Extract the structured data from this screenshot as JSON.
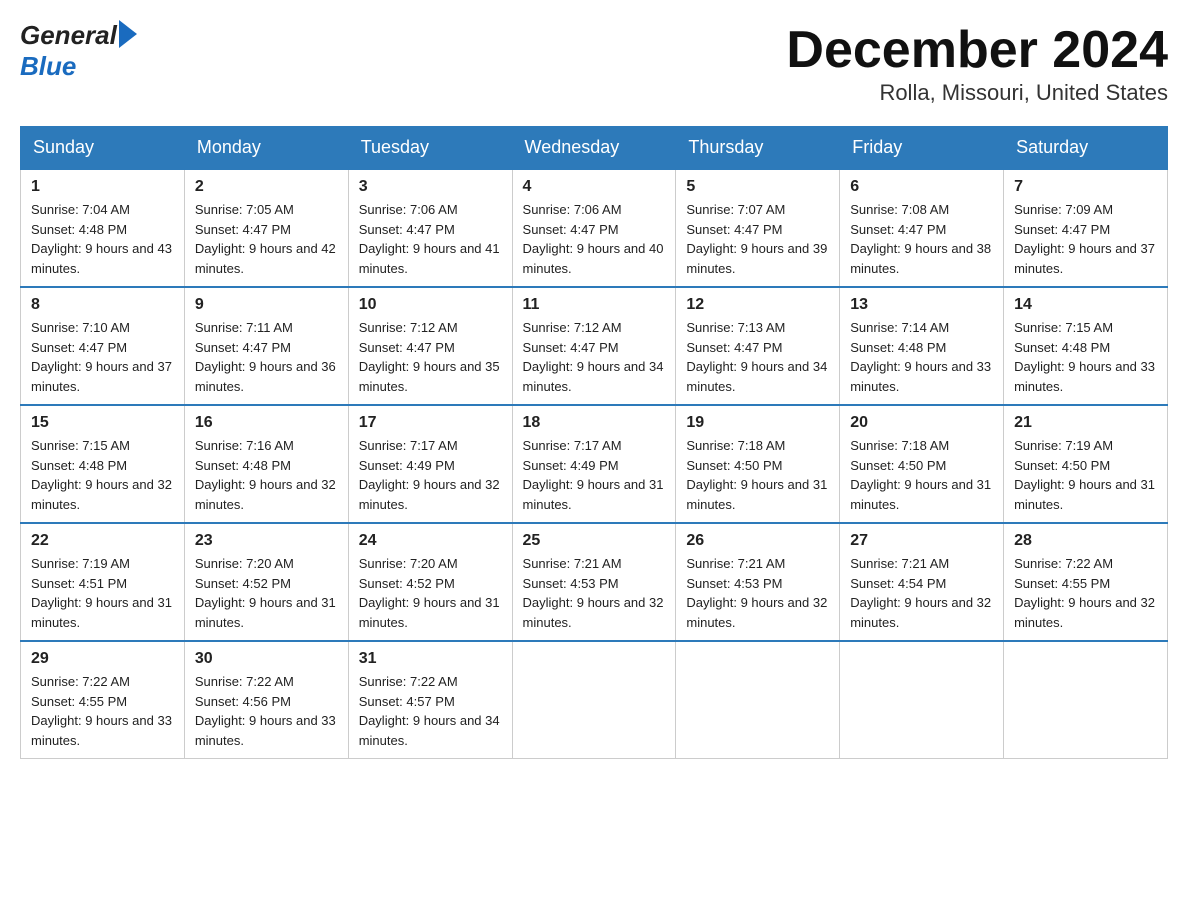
{
  "header": {
    "logo_general": "General",
    "logo_blue": "Blue",
    "month_title": "December 2024",
    "location": "Rolla, Missouri, United States"
  },
  "days_of_week": [
    "Sunday",
    "Monday",
    "Tuesday",
    "Wednesday",
    "Thursday",
    "Friday",
    "Saturday"
  ],
  "weeks": [
    [
      {
        "day": "1",
        "sunrise": "7:04 AM",
        "sunset": "4:48 PM",
        "daylight": "9 hours and 43 minutes."
      },
      {
        "day": "2",
        "sunrise": "7:05 AM",
        "sunset": "4:47 PM",
        "daylight": "9 hours and 42 minutes."
      },
      {
        "day": "3",
        "sunrise": "7:06 AM",
        "sunset": "4:47 PM",
        "daylight": "9 hours and 41 minutes."
      },
      {
        "day": "4",
        "sunrise": "7:06 AM",
        "sunset": "4:47 PM",
        "daylight": "9 hours and 40 minutes."
      },
      {
        "day": "5",
        "sunrise": "7:07 AM",
        "sunset": "4:47 PM",
        "daylight": "9 hours and 39 minutes."
      },
      {
        "day": "6",
        "sunrise": "7:08 AM",
        "sunset": "4:47 PM",
        "daylight": "9 hours and 38 minutes."
      },
      {
        "day": "7",
        "sunrise": "7:09 AM",
        "sunset": "4:47 PM",
        "daylight": "9 hours and 37 minutes."
      }
    ],
    [
      {
        "day": "8",
        "sunrise": "7:10 AM",
        "sunset": "4:47 PM",
        "daylight": "9 hours and 37 minutes."
      },
      {
        "day": "9",
        "sunrise": "7:11 AM",
        "sunset": "4:47 PM",
        "daylight": "9 hours and 36 minutes."
      },
      {
        "day": "10",
        "sunrise": "7:12 AM",
        "sunset": "4:47 PM",
        "daylight": "9 hours and 35 minutes."
      },
      {
        "day": "11",
        "sunrise": "7:12 AM",
        "sunset": "4:47 PM",
        "daylight": "9 hours and 34 minutes."
      },
      {
        "day": "12",
        "sunrise": "7:13 AM",
        "sunset": "4:47 PM",
        "daylight": "9 hours and 34 minutes."
      },
      {
        "day": "13",
        "sunrise": "7:14 AM",
        "sunset": "4:48 PM",
        "daylight": "9 hours and 33 minutes."
      },
      {
        "day": "14",
        "sunrise": "7:15 AM",
        "sunset": "4:48 PM",
        "daylight": "9 hours and 33 minutes."
      }
    ],
    [
      {
        "day": "15",
        "sunrise": "7:15 AM",
        "sunset": "4:48 PM",
        "daylight": "9 hours and 32 minutes."
      },
      {
        "day": "16",
        "sunrise": "7:16 AM",
        "sunset": "4:48 PM",
        "daylight": "9 hours and 32 minutes."
      },
      {
        "day": "17",
        "sunrise": "7:17 AM",
        "sunset": "4:49 PM",
        "daylight": "9 hours and 32 minutes."
      },
      {
        "day": "18",
        "sunrise": "7:17 AM",
        "sunset": "4:49 PM",
        "daylight": "9 hours and 31 minutes."
      },
      {
        "day": "19",
        "sunrise": "7:18 AM",
        "sunset": "4:50 PM",
        "daylight": "9 hours and 31 minutes."
      },
      {
        "day": "20",
        "sunrise": "7:18 AM",
        "sunset": "4:50 PM",
        "daylight": "9 hours and 31 minutes."
      },
      {
        "day": "21",
        "sunrise": "7:19 AM",
        "sunset": "4:50 PM",
        "daylight": "9 hours and 31 minutes."
      }
    ],
    [
      {
        "day": "22",
        "sunrise": "7:19 AM",
        "sunset": "4:51 PM",
        "daylight": "9 hours and 31 minutes."
      },
      {
        "day": "23",
        "sunrise": "7:20 AM",
        "sunset": "4:52 PM",
        "daylight": "9 hours and 31 minutes."
      },
      {
        "day": "24",
        "sunrise": "7:20 AM",
        "sunset": "4:52 PM",
        "daylight": "9 hours and 31 minutes."
      },
      {
        "day": "25",
        "sunrise": "7:21 AM",
        "sunset": "4:53 PM",
        "daylight": "9 hours and 32 minutes."
      },
      {
        "day": "26",
        "sunrise": "7:21 AM",
        "sunset": "4:53 PM",
        "daylight": "9 hours and 32 minutes."
      },
      {
        "day": "27",
        "sunrise": "7:21 AM",
        "sunset": "4:54 PM",
        "daylight": "9 hours and 32 minutes."
      },
      {
        "day": "28",
        "sunrise": "7:22 AM",
        "sunset": "4:55 PM",
        "daylight": "9 hours and 32 minutes."
      }
    ],
    [
      {
        "day": "29",
        "sunrise": "7:22 AM",
        "sunset": "4:55 PM",
        "daylight": "9 hours and 33 minutes."
      },
      {
        "day": "30",
        "sunrise": "7:22 AM",
        "sunset": "4:56 PM",
        "daylight": "9 hours and 33 minutes."
      },
      {
        "day": "31",
        "sunrise": "7:22 AM",
        "sunset": "4:57 PM",
        "daylight": "9 hours and 34 minutes."
      },
      null,
      null,
      null,
      null
    ]
  ],
  "labels": {
    "sunrise": "Sunrise:",
    "sunset": "Sunset:",
    "daylight": "Daylight:"
  }
}
